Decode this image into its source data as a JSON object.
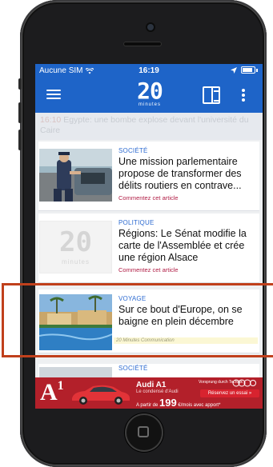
{
  "status_bar": {
    "carrier": "Aucune SIM",
    "time": "16:19"
  },
  "header": {
    "logo_number": "20",
    "logo_subtitle": "minutes"
  },
  "ticker": {
    "time": "16:10",
    "text": "Egypte: une bombe explose devant l'université du Caire"
  },
  "articles": [
    {
      "category": "SOCIÉTÉ",
      "title": "Une mission parlementaire propose de transformer des délits routiers en contrave...",
      "comment_link": "Commentez cet article"
    },
    {
      "category": "POLITIQUE",
      "title": "Régions: Le Sénat modifie la carte de l'Assemblée et crée une région Alsace",
      "comment_link": "Commentez cet article",
      "thumb_number": "20",
      "thumb_subtitle": "minutes"
    },
    {
      "category": "VOYAGE",
      "title": "Sur ce bout d'Europe, on se baigne en plein décembre",
      "sponsor": "20 Minutes Communication"
    },
    {
      "category": "SOCIÉTÉ"
    }
  ],
  "ad": {
    "logo": "A",
    "logo_sup": "1",
    "title": "Audi A1",
    "subtitle": "Le condensé d'Audi",
    "price_prefix": "A partir de",
    "price": "199",
    "price_suffix": "€/mois avec apport*",
    "brand": "Vorsprung durch Technik",
    "cta": "Réservez un essai"
  },
  "colors": {
    "header_blue": "#1e64c8",
    "highlight_border": "#c0401c",
    "ad_red": "#b3202a"
  }
}
